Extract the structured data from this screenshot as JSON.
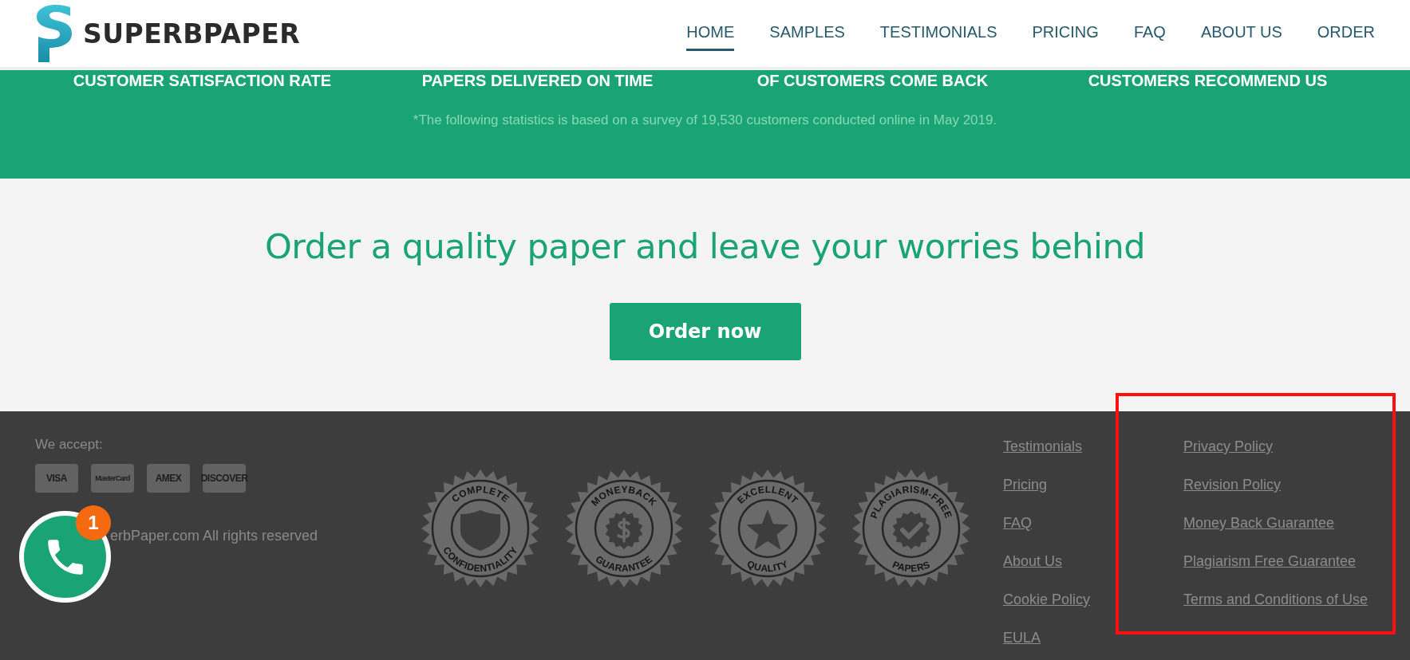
{
  "brand": {
    "name": "SUPERBPAPER"
  },
  "nav": [
    {
      "label": "HOME",
      "selected": true
    },
    {
      "label": "SAMPLES",
      "selected": false
    },
    {
      "label": "TESTIMONIALS",
      "selected": false
    },
    {
      "label": "PRICING",
      "selected": false
    },
    {
      "label": "FAQ",
      "selected": false
    },
    {
      "label": "ABOUT US",
      "selected": false
    },
    {
      "label": "ORDER",
      "selected": false
    }
  ],
  "stats": {
    "labels": [
      "CUSTOMER SATISFACTION RATE",
      "PAPERS DELIVERED ON TIME",
      "OF CUSTOMERS COME BACK",
      "CUSTOMERS RECOMMEND US"
    ],
    "note": "*The following statistics is based on a survey of 19,530 customers conducted online in May 2019."
  },
  "cta": {
    "heading": "Order a quality paper and leave your worries behind",
    "button": "Order now"
  },
  "footer": {
    "accept_label": "We accept:",
    "cards": [
      {
        "label": "VISA",
        "kind": "visa"
      },
      {
        "label": "MasterCard",
        "kind": "mastercard"
      },
      {
        "label": "AMEX",
        "kind": "amex"
      },
      {
        "label": "DISCOVER",
        "kind": "discover"
      }
    ],
    "copyright": "erbPaper.com All rights reserved",
    "seals": [
      {
        "top": "COMPLETE",
        "bottom": "CONFIDENTIALITY",
        "kind": "shield"
      },
      {
        "top": "MONEYBACK",
        "bottom": "GUARANTEE",
        "kind": "dollar"
      },
      {
        "top": "EXCELLENT",
        "bottom": "QUALITY",
        "kind": "star"
      },
      {
        "top": "PLAGIARISM-FREE",
        "bottom": "PAPERS",
        "kind": "check"
      }
    ],
    "links_1": [
      "Testimonials",
      "Pricing",
      "FAQ",
      "About Us",
      "Cookie Policy",
      "EULA"
    ],
    "links_2": [
      "Privacy Policy",
      "Revision Policy",
      "Money Back Guarantee",
      "Plagiarism Free Guarantee",
      "Terms and Conditions of Use"
    ]
  },
  "call_widget": {
    "count": "1"
  }
}
